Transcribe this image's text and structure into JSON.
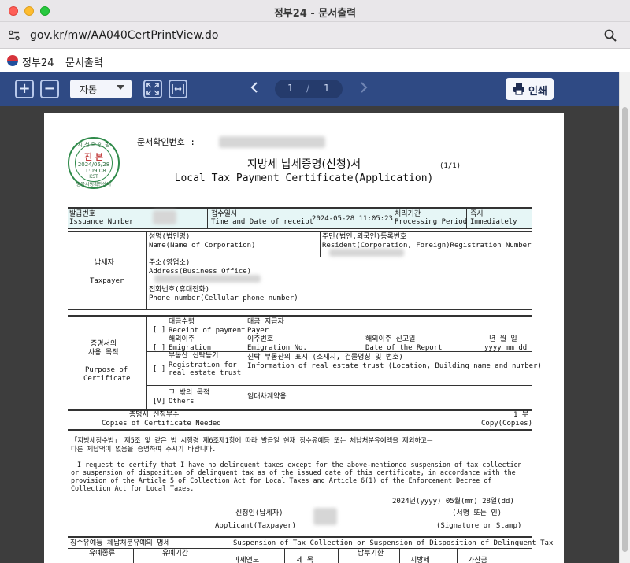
{
  "window": {
    "title": "정부24 - 문서출력"
  },
  "urlbar": {
    "url": "gov.kr/mw/AA040CertPrintView.do"
  },
  "site": {
    "brand": "정부24",
    "crumb": "문서출력"
  },
  "toolbar": {
    "zoom_in": "+",
    "zoom_out": "−",
    "zoom_select": "자동",
    "prev": "‹",
    "next": "›",
    "current_page": "1",
    "page_sep": "/",
    "total_pages": "1",
    "print_label": "인쇄"
  },
  "doc": {
    "doc_no_label": "문서확인번호 :",
    "stamp": {
      "top": "시 청 확 인 필",
      "mid": "진 본",
      "date": "2024/05/28",
      "time": "11:09:08",
      "tz": "KST",
      "bottom": "충북시청확인센터"
    },
    "title_ko": "지방세 납세증명(신청)서",
    "title_en": "Local Tax Payment Certificate(Application)",
    "page_count": "(1/1)",
    "head": {
      "issuance_ko": "발급번호",
      "issuance_en": "Issuance Number",
      "receipt_ko": "접수일시",
      "receipt_en": "Time and Date of receipt",
      "receipt_value": "2024-05-28 11:05:23",
      "period_ko": "처리기간",
      "period_en": "Processing Period",
      "period_value_ko": "즉시",
      "period_value_en": "Immediately"
    },
    "taxpayer": {
      "label_ko": "납세자",
      "label_en": "Taxpayer",
      "name_ko": "성명(법인명)",
      "name_en": "Name(Name of Corporation)",
      "rrn_ko": "주민(법인,외국인)등록번호",
      "rrn_en": "Resident(Corporation, Foreign)Registration Number",
      "address_ko": "주소(영업소)",
      "address_en": "Address(Business Office)",
      "phone_ko": "전화번호(휴대전화)",
      "phone_en": "Phone number(Cellular phone number)"
    },
    "purpose": {
      "label_ko1": "증명서의",
      "label_ko2": "사용 목적",
      "label_en1": "Purpose of",
      "label_en2": "Certificate",
      "rows": [
        {
          "mark": "[ ]",
          "ko": "대금수령",
          "en": "Receipt of payment",
          "r1": "대금 지급자",
          "r2": "Payer"
        },
        {
          "mark": "[ ]",
          "ko": "해외이주",
          "en": "Emigration",
          "r1": "이주번호",
          "r1b": "해외이주 신고일",
          "r1c": "년 월 일",
          "r2": "Emigration No.",
          "r2b": "Date of the Report",
          "r2c": "yyyy  mm  dd"
        },
        {
          "mark": "[ ]",
          "ko": "부동산 신탁등기",
          "en": "Registration for",
          "en2": "real estate trust",
          "r1": "신탁 부동산의 표시 (소재지, 건물명칭 및 번호)",
          "r2": "Information of real estate trust (Location, Building name and number)"
        },
        {
          "mark": "[V]",
          "ko": "그 밖의 목적",
          "en": "Others",
          "r1": "임대차계약용"
        }
      ]
    },
    "copies": {
      "ko": "증명서 신청부수",
      "en": "Copies of Certificate Needed",
      "value_ko": "1 부",
      "value_en": "Copy(Copies)"
    },
    "statement_ko1": "「지방세징수법」 제5조 및 같은 법 시행령 제6조제1항에 따라 발급일 현재 징수유예등 또는 체납처분유예액을 제외하고는",
    "statement_ko2": "다른 체납액이 없음을 증명하여 주시기 바랍니다.",
    "statement_en1": "I request to certify that I have no delinquent taxes except for the above-mentioned suspension of tax collection",
    "statement_en2": "or suspension of disposition of delinquent tax as of the issued date of this certificate, in accordance with the",
    "statement_en3": "provision of the Article 5 of Collection Act for Local Taxes and Article 6(1) of the Enforcement Decree of",
    "statement_en4": "Collection Act for Local Taxes.",
    "date": "2024년(yyyy) 05월(mm) 28일(dd)",
    "applicant_ko": "신청인(납세자)",
    "applicant_en": "Applicant(Taxpayer)",
    "sign_ko": "(서명 또는 인)",
    "sign_en": "(Signature or Stamp)",
    "bottom_ko": "징수유예등 체납처분유예의 명세",
    "bottom_en": "Suspension of Tax Collection or Suspension of Disposition of Delinquent Tax",
    "bottom_cols": [
      "유예종류",
      "유예기간",
      "과세연도",
      "세 목",
      "납부기한",
      "지방세",
      "가산금"
    ]
  }
}
